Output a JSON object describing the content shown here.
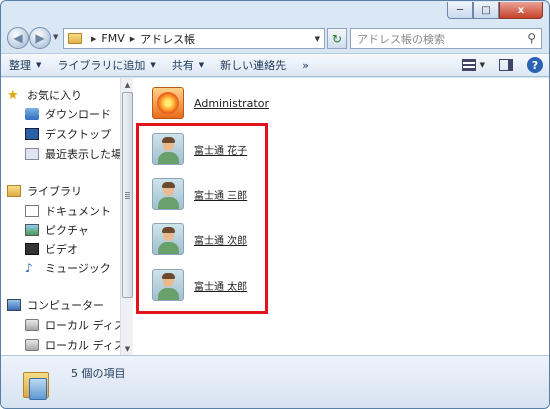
{
  "window": {
    "controls": {
      "minimize": "─",
      "maximize": "□",
      "close": "x"
    }
  },
  "address": {
    "crumbs": [
      "FMV",
      "アドレス帳"
    ],
    "search_placeholder": "アドレス帳の検索"
  },
  "toolbar": {
    "organize": "整理",
    "include_in_library": "ライブラリに追加",
    "share": "共有",
    "new_contact": "新しい連絡先",
    "more": "»"
  },
  "nav": {
    "favorites": "お気に入り",
    "downloads": "ダウンロード",
    "desktop": "デスクトップ",
    "recent": "最近表示した場所",
    "libraries": "ライブラリ",
    "documents": "ドキュメント",
    "pictures": "ピクチャ",
    "videos": "ビデオ",
    "music": "ミュージック",
    "computer": "コンピューター",
    "local_disk_1": "ローカル ディスク",
    "local_disk_2": "ローカル ディスク"
  },
  "contacts": [
    {
      "name": "Administrator"
    },
    {
      "name": "富士通 花子"
    },
    {
      "name": "富士通 三郎"
    },
    {
      "name": "富士通 次郎"
    },
    {
      "name": "富士通 太郎"
    }
  ],
  "status": {
    "item_count": "5 個の項目"
  }
}
